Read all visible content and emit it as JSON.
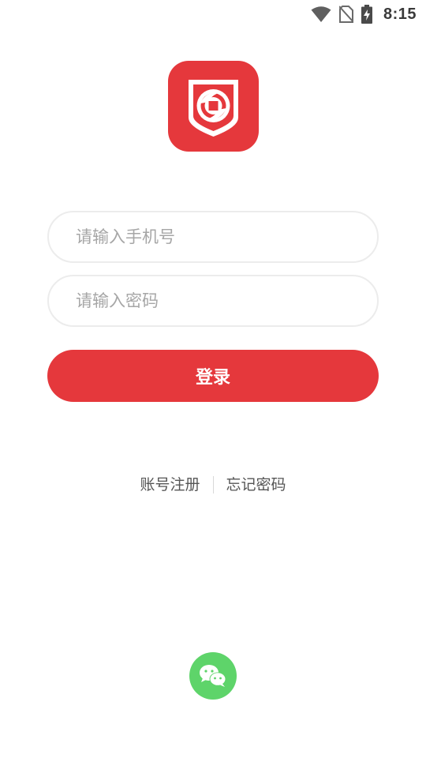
{
  "status_bar": {
    "time": "8:15",
    "icons": [
      "wifi-icon",
      "no-sim-icon",
      "battery-charging-icon"
    ]
  },
  "logo": {
    "icon": "shield-logo-icon",
    "background_color": "#e5383c"
  },
  "form": {
    "phone_placeholder": "请输入手机号",
    "phone_value": "",
    "password_placeholder": "请输入密码",
    "password_value": "",
    "login_label": "登录"
  },
  "links": {
    "register_label": "账号注册",
    "forgot_label": "忘记密码"
  },
  "social": {
    "wechat_icon": "wechat-icon",
    "wechat_color": "#5ed46a"
  },
  "colors": {
    "accent": "#e5383c",
    "input_border": "#ececec",
    "placeholder": "#a6a6a6",
    "link_text": "#555555"
  }
}
